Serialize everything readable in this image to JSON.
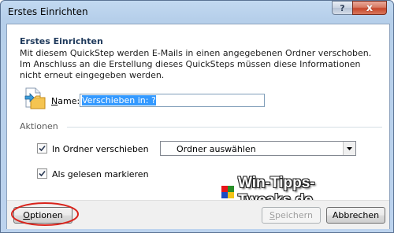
{
  "window": {
    "title": "Erstes Einrichten",
    "help_glyph": "?",
    "close_glyph": "x"
  },
  "dialog": {
    "heading": "Erstes Einrichten",
    "description": "Mit diesem QuickStep werden E-Mails in einen angegebenen Ordner verschoben. Im Anschluss an die Erstellung dieses QuickSteps müssen diese Informationen nicht erneut eingegeben werden.",
    "icon": "folder-arrow-icon"
  },
  "name_field": {
    "label_accel": "N",
    "label_rest": "ame:",
    "value": "Verschieben in: ?"
  },
  "actions": {
    "section_label": "Aktionen",
    "move_to_folder": {
      "label": "In Ordner verschieben",
      "checked": true
    },
    "folder_select": {
      "selected": "Ordner auswählen"
    },
    "mark_as_read": {
      "label": "Als gelesen markieren",
      "checked": true
    }
  },
  "watermark": {
    "text": "Win-Tipps-Tweaks.de",
    "logo_colors": [
      "#e8151a",
      "#2a8f2a",
      "#1c4bc4",
      "#f2c418"
    ]
  },
  "footer": {
    "options_accel": "O",
    "options_rest": "ptionen",
    "save_accel": "S",
    "save_rest": "peichern",
    "cancel_label": "Abbrechen"
  },
  "colors": {
    "highlight_ellipse": "#d9241c",
    "selection": "#3399ff"
  }
}
